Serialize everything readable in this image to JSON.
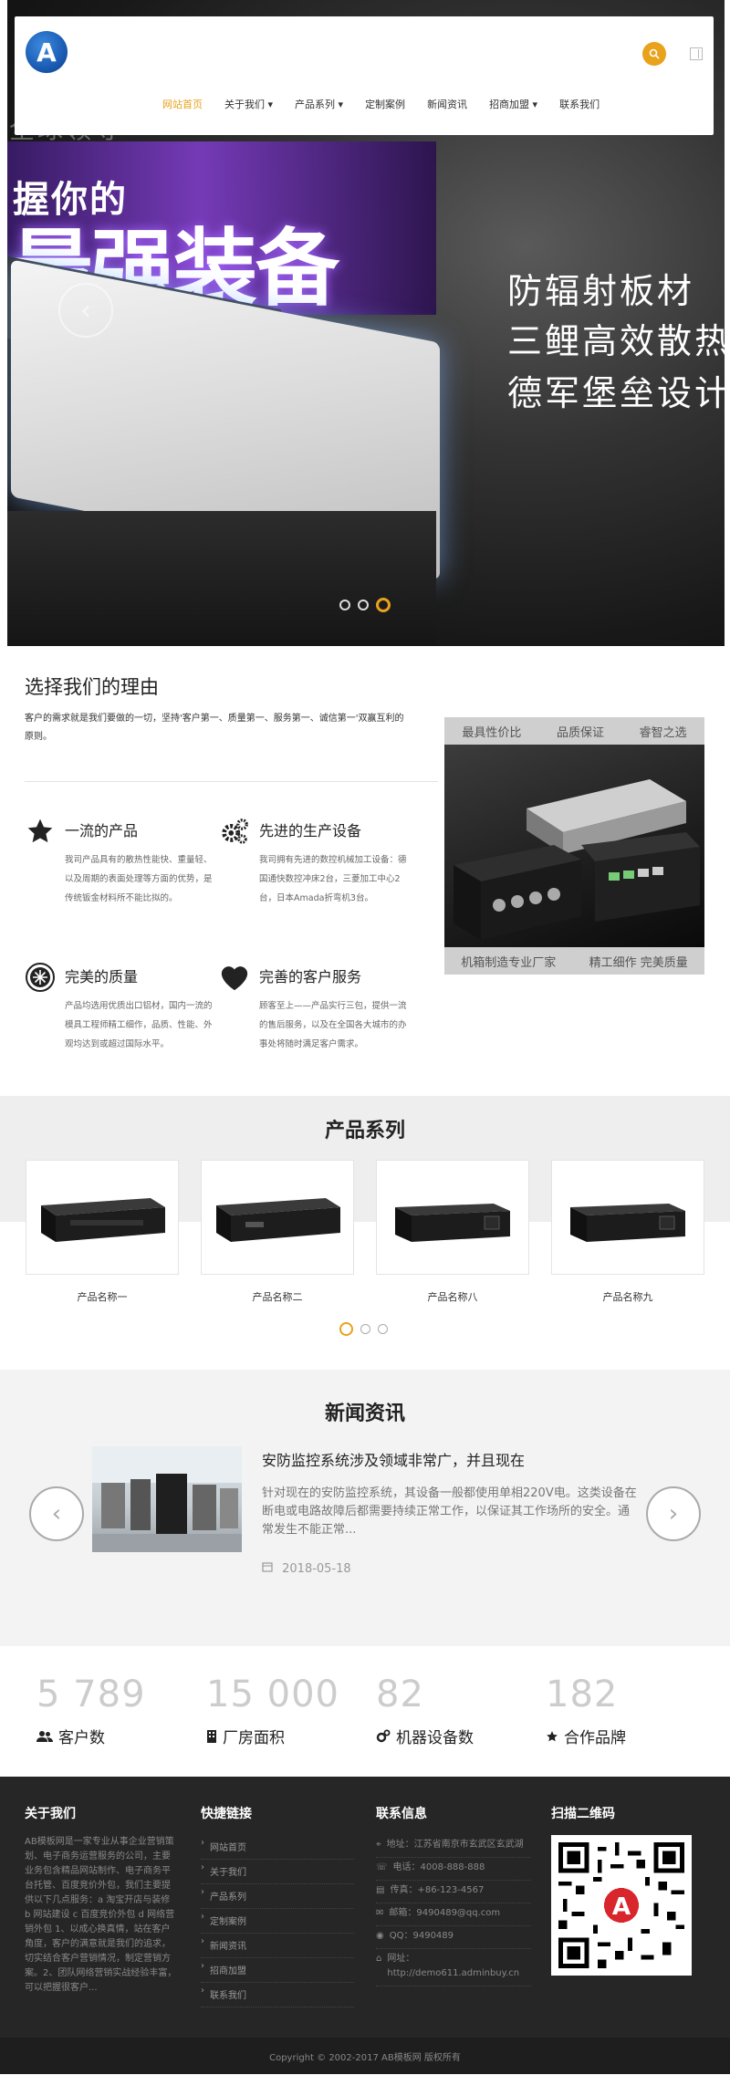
{
  "header": {
    "logo_letter": "A",
    "nav": [
      {
        "label": "网站首页",
        "active": true
      },
      {
        "label": "关于我们 ▾",
        "active": false
      },
      {
        "label": "产品系列 ▾",
        "active": false
      },
      {
        "label": "定制案例",
        "active": false
      },
      {
        "label": "新闻资讯",
        "active": false
      },
      {
        "label": "招商加盟 ▾",
        "active": false
      },
      {
        "label": "联系我们",
        "active": false
      }
    ]
  },
  "hero": {
    "faded_line": "全球领导",
    "title_small": "握你的",
    "title_big": "最强装备",
    "right_lines": [
      "防辐射板材",
      "三鲤高效散热",
      "德军堡垒设计"
    ],
    "dots": 3,
    "active_dot": 2
  },
  "why": {
    "title": "选择我们的理由",
    "desc": "客户的需求就是我们要做的一切，坚持'客户第一、质量第一、服务第一、诚信第一'双赢互利的原则。",
    "features": [
      {
        "icon": "star-icon",
        "title": "一流的产品",
        "text": "我司产品具有的散热性能快、重量轻、以及周期的表面处理等方面的优势，是传统钣金材料所不能比拟的。"
      },
      {
        "icon": "gears-icon",
        "title": "先进的生产设备",
        "text": "我司拥有先进的数控机械加工设备：德国通快数控冲床2台，三菱加工中心2台，日本Amada折弯机3台。"
      },
      {
        "icon": "quality-icon",
        "title": "完美的质量",
        "text": "产品均选用优质出口铝材，国内一流的模具工程师精工细作，品质、性能、外观均达到或超过国际水平。"
      },
      {
        "icon": "heart-icon",
        "title": "完善的客户服务",
        "text": "顾客至上——产品实行三包，提供一流的售后服务，以及在全国各大城市的办事处将随时满足客户需求。"
      }
    ],
    "card_top": [
      "最具性价比",
      "品质保证",
      "睿智之选"
    ],
    "card_bottom": [
      "机箱制造专业厂家",
      "精工细作 完美质量"
    ]
  },
  "products": {
    "title": "产品系列",
    "items": [
      {
        "name": "产品名称一"
      },
      {
        "name": "产品名称二"
      },
      {
        "name": "产品名称八"
      },
      {
        "name": "产品名称九"
      }
    ],
    "dots": 3,
    "active_dot": 0
  },
  "news": {
    "title": "新闻资讯",
    "headline": "安防监控系统涉及领域非常广，并且现在",
    "body": "针对现在的安防监控系统，其设备一般都使用单相220V电。这类设备在断电或电路故障后都需要持续正常工作，以保证其工作场所的安全。通常发生不能正常...",
    "date": "2018-05-18",
    "prev_arrow": "‹",
    "next_arrow": "›"
  },
  "stats": [
    {
      "num": "5 789",
      "label": "客户数",
      "icon": "users-icon"
    },
    {
      "num": "15 000",
      "label": "厂房面积",
      "icon": "building-icon"
    },
    {
      "num": "82",
      "label": "机器设备数",
      "icon": "gears-icon"
    },
    {
      "num": "182",
      "label": "合作品牌",
      "icon": "star-icon"
    }
  ],
  "footer": {
    "about_title": "关于我们",
    "about_text": "AB模板网是一家专业从事企业营销策划、电子商务运营服务的公司，主要业务包含精品网站制作、电子商务平台托管、百度竞价外包，我们主要提供以下几点服务：a 淘宝开店与装修 b 网站建设 c 百度竞价外包 d 网络营销外包 1、以成心换真情，站在客户角度，客户的满意就是我们的追求，切实结合客户营销情况，制定营销方案。2、团队网络营销实战经验丰富，可以把握很客户...",
    "links_title": "快捷链接",
    "links": [
      "网站首页",
      "关于我们",
      "产品系列",
      "定制案例",
      "新闻资讯",
      "招商加盟",
      "联系我们"
    ],
    "contact_title": "联系信息",
    "contacts": [
      {
        "icon": "location-icon",
        "text": "地址：江苏省南京市玄武区玄武湖"
      },
      {
        "icon": "phone-icon",
        "text": "电话：4008-888-888"
      },
      {
        "icon": "fax-icon",
        "text": "传真：+86-123-4567"
      },
      {
        "icon": "mail-icon",
        "text": "邮箱：9490489@qq.com"
      },
      {
        "icon": "qq-icon",
        "text": "QQ：9490489"
      },
      {
        "icon": "home-icon",
        "text": "网址：http://demo611.adminbuy.cn"
      }
    ],
    "qr_title": "扫描二维码",
    "copyright": "Copyright © 2002-2017 AB模板网 版权所有"
  },
  "colors": {
    "accent": "#e8a21b",
    "footer_bg": "#262626"
  }
}
